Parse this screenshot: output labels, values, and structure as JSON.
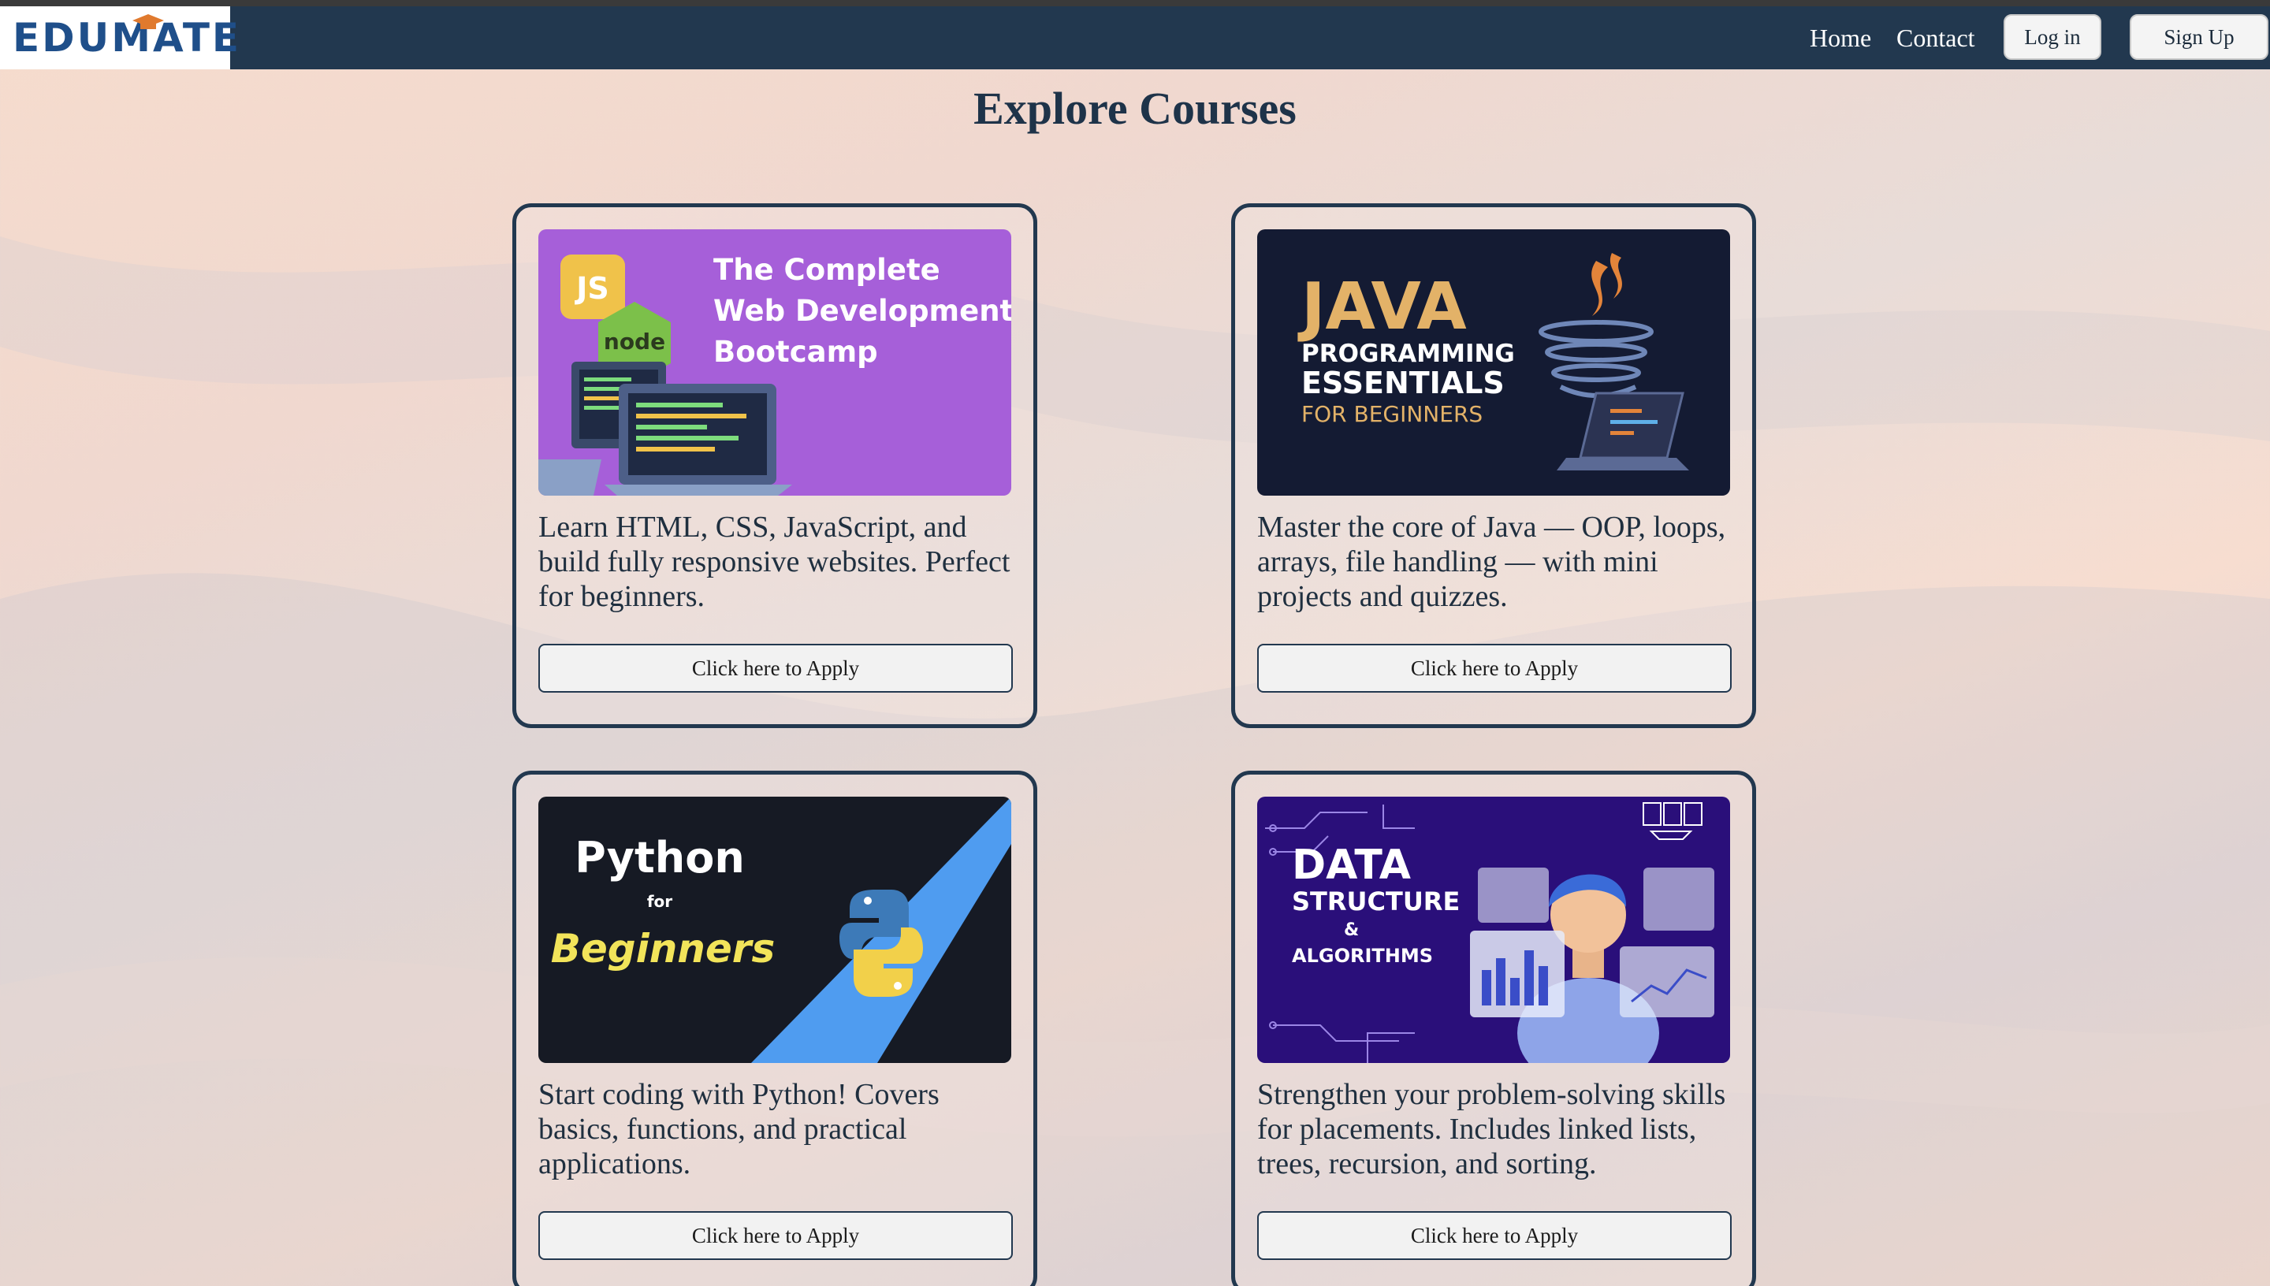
{
  "brand": {
    "logo_text": "EDUMATE"
  },
  "nav": {
    "home": "Home",
    "contact": "Contact",
    "login": "Log in",
    "signup": "Sign Up"
  },
  "page": {
    "title": "Explore Courses"
  },
  "courses": [
    {
      "image_lines": [
        "The Complete",
        "Web Development",
        "Bootcamp"
      ],
      "image_badges": [
        "JS",
        "node"
      ],
      "description": "Learn HTML, CSS, JavaScript, and build fully responsive websites. Perfect for beginners.",
      "button": "Click here to Apply"
    },
    {
      "image_lines": [
        "JAVA",
        "PROGRAMMING",
        "ESSENTIALS",
        "FOR BEGINNERS"
      ],
      "description": "Master the core of Java — OOP, loops, arrays, file handling — with mini projects and quizzes.",
      "button": "Click here to Apply"
    },
    {
      "image_lines": [
        "Python",
        "for",
        "Beginners"
      ],
      "description": "Start coding with Python! Covers basics, functions, and practical applications.",
      "button": "Click here to Apply"
    },
    {
      "image_lines": [
        "DATA",
        "STRUCTURE",
        "&",
        "ALGORITHMS"
      ],
      "description": "Strengthen your problem-solving skills for placements. Includes linked lists, trees, recursion, and sorting.",
      "button": "Click here to Apply"
    }
  ],
  "colors": {
    "navbar": "#22384f",
    "logo": "#1f4f8a",
    "card_border": "#22384f",
    "web_banner": "#a65fd9",
    "java_banner": "#141b33",
    "python_banner": "#161a24",
    "dsa_banner": "#2a0f7a"
  }
}
